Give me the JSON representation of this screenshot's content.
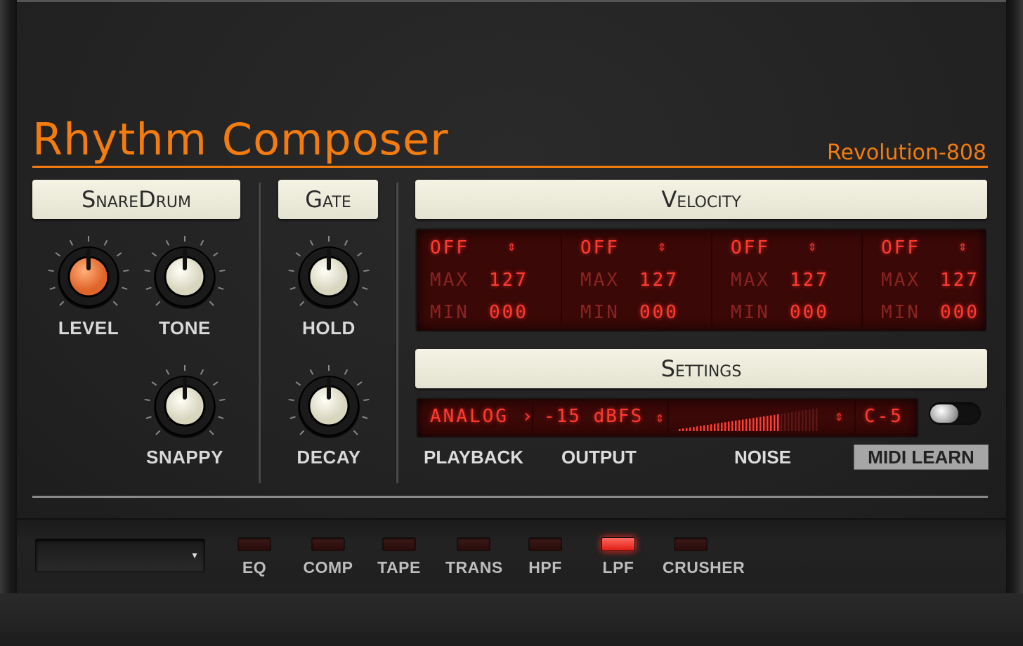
{
  "app": {
    "title": "Rhythm Composer",
    "model": "Revolution-808",
    "accent_color": "#f47b0d"
  },
  "snare": {
    "label": "SnareDrum",
    "knobs": [
      {
        "name": "LEVEL",
        "value": 0.5,
        "highlighted": true
      },
      {
        "name": "TONE",
        "value": 0.5
      },
      {
        "name": "SNAPPY",
        "value": 0.5
      }
    ]
  },
  "gate": {
    "label": "Gate",
    "knobs": [
      {
        "name": "HOLD",
        "value": 0.5
      },
      {
        "name": "DECAY",
        "value": 0.5
      }
    ]
  },
  "velocity": {
    "label": "Velocity",
    "columns": [
      {
        "mode": "OFF",
        "max_label": "MAX",
        "max": "127",
        "min_label": "MIN",
        "min": "000"
      },
      {
        "mode": "OFF",
        "max_label": "MAX",
        "max": "127",
        "min_label": "MIN",
        "min": "000"
      },
      {
        "mode": "OFF",
        "max_label": "MAX",
        "max": "127",
        "min_label": "MIN",
        "min": "000"
      },
      {
        "mode": "OFF",
        "max_label": "MAX",
        "max": "127",
        "min_label": "MIN",
        "min": "000"
      }
    ]
  },
  "settings": {
    "label": "Settings",
    "playback_value": "ANALOG",
    "output_value": "-15 dBFS",
    "noise_level": 0.72,
    "note_value": "C-5",
    "playback_label": "PLAYBACK",
    "output_label": "OUTPUT",
    "noise_label": "NOISE",
    "midi_learn_label": "MIDI LEARN",
    "toggle_on": false
  },
  "effects": [
    {
      "label": "EQ",
      "on": false
    },
    {
      "label": "COMP",
      "on": false
    },
    {
      "label": "TAPE",
      "on": false
    },
    {
      "label": "TRANS",
      "on": false
    },
    {
      "label": "HPF",
      "on": false
    },
    {
      "label": "LPF",
      "on": true
    },
    {
      "label": "CRUSHER",
      "on": false
    }
  ],
  "preset": {
    "value": ""
  }
}
